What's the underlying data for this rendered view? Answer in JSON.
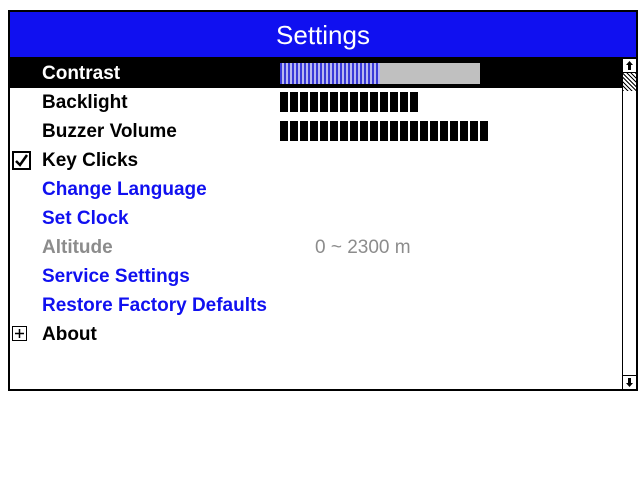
{
  "window": {
    "title": "Settings"
  },
  "settings": {
    "items": [
      {
        "label": "Contrast",
        "control": "slider",
        "level_percent": 50
      },
      {
        "label": "Backlight",
        "control": "segments",
        "segments": 14
      },
      {
        "label": "Buzzer Volume",
        "control": "segments",
        "segments": 21
      },
      {
        "label": "Key Clicks",
        "control": "checkbox",
        "checked": true,
        "icon": "checkmark-icon"
      },
      {
        "label": "Change Language",
        "control": "link"
      },
      {
        "label": "Set Clock",
        "control": "link"
      },
      {
        "label": "Altitude",
        "control": "disabled",
        "value": "0 ~ 2300 m"
      },
      {
        "label": "Service Settings",
        "control": "link"
      },
      {
        "label": "Restore Factory Defaults",
        "control": "link"
      },
      {
        "label": "About",
        "control": "expandable",
        "icon": "plus-box-icon"
      }
    ],
    "selected_index": 0
  },
  "scrollbar": {
    "up_icon": "arrow-up-icon",
    "down_icon": "arrow-down-icon"
  },
  "colors": {
    "title_bar": "#1010f0",
    "link_text": "#1010f0",
    "disabled_text": "#8c8c8c",
    "slider_track": "#c0c0c0",
    "slider_fill": "#3a3ad8",
    "selected_row": "#000000"
  }
}
